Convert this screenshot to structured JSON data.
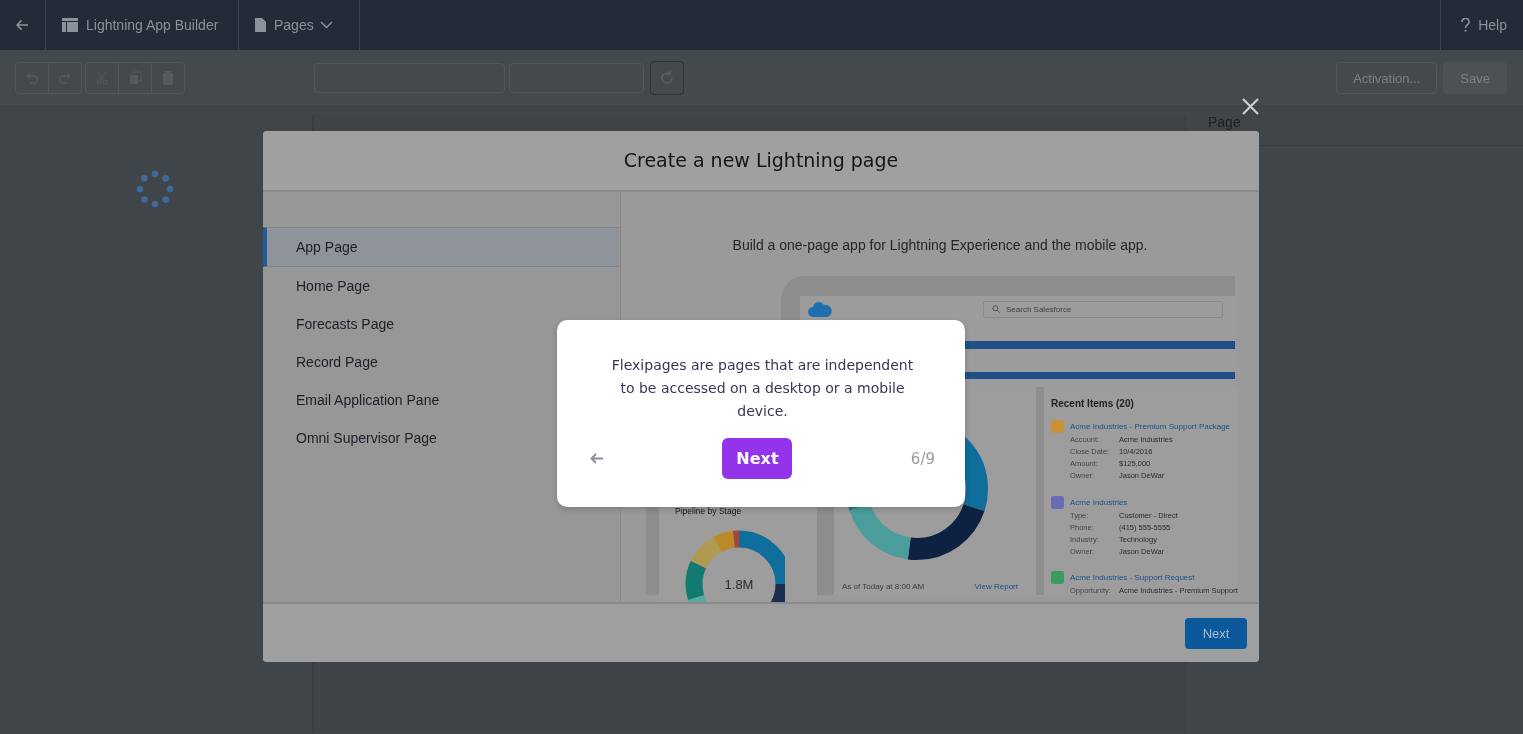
{
  "top_bar": {
    "app_title": "Lightning App Builder",
    "pages_menu": "Pages",
    "help": "Help"
  },
  "toolbar": {
    "buttons": [
      {
        "label": "Activation...",
        "kind": "outline"
      },
      {
        "label": "Save",
        "kind": "solid"
      }
    ]
  },
  "properties_panel": {
    "title": "Page"
  },
  "modal": {
    "title": "Create a new Lightning page",
    "page_types": [
      {
        "label": "App Page",
        "selected": true
      },
      {
        "label": "Home Page",
        "selected": false
      },
      {
        "label": "Forecasts Page",
        "selected": false
      },
      {
        "label": "Record Page",
        "selected": false
      },
      {
        "label": "Email Application Pane",
        "selected": false
      },
      {
        "label": "Omni Supervisor Page",
        "selected": false
      }
    ],
    "description": "Build a one-page app for Lightning Experience and the mobile app.",
    "preview": {
      "search_placeholder": "Search Salesforce",
      "pipeline_title": "Pipeline by Stage",
      "pipeline_total": "1.8M",
      "report_note": "As of Today at 8:00 AM",
      "report_link": "View Report",
      "recent_title": "Recent Items (20)",
      "recent_items": [
        {
          "title": "Acme Industries - Premium Support Package",
          "color": "#c8913a",
          "fields": [
            {
              "label": "Account:",
              "value": "Acme Industries"
            },
            {
              "label": "Close Date:",
              "value": "10/4/2016"
            },
            {
              "label": "Amount:",
              "value": "$125,000"
            },
            {
              "label": "Owner:",
              "value": "Jason DeWar"
            }
          ]
        },
        {
          "title": "Acme Industries",
          "color": "#6b6db3",
          "fields": [
            {
              "label": "Type:",
              "value": "Customer - Direct"
            },
            {
              "label": "Phone:",
              "value": "(415) 555-5555"
            },
            {
              "label": "Industry:",
              "value": "Technology"
            },
            {
              "label": "Owner:",
              "value": "Jason DeWar"
            }
          ]
        },
        {
          "title": "Acme Industries - Support Request",
          "color": "#3f9a5f",
          "fields": [
            {
              "label": "Opportunity:",
              "value": "Acme Industries - Premium Support"
            }
          ]
        }
      ]
    },
    "next_button": "Next"
  },
  "tour": {
    "message": "Flexipages are pages that are independent to be accessed on a desktop or a mobile device.",
    "next_button": "Next",
    "progress": "6/9"
  }
}
